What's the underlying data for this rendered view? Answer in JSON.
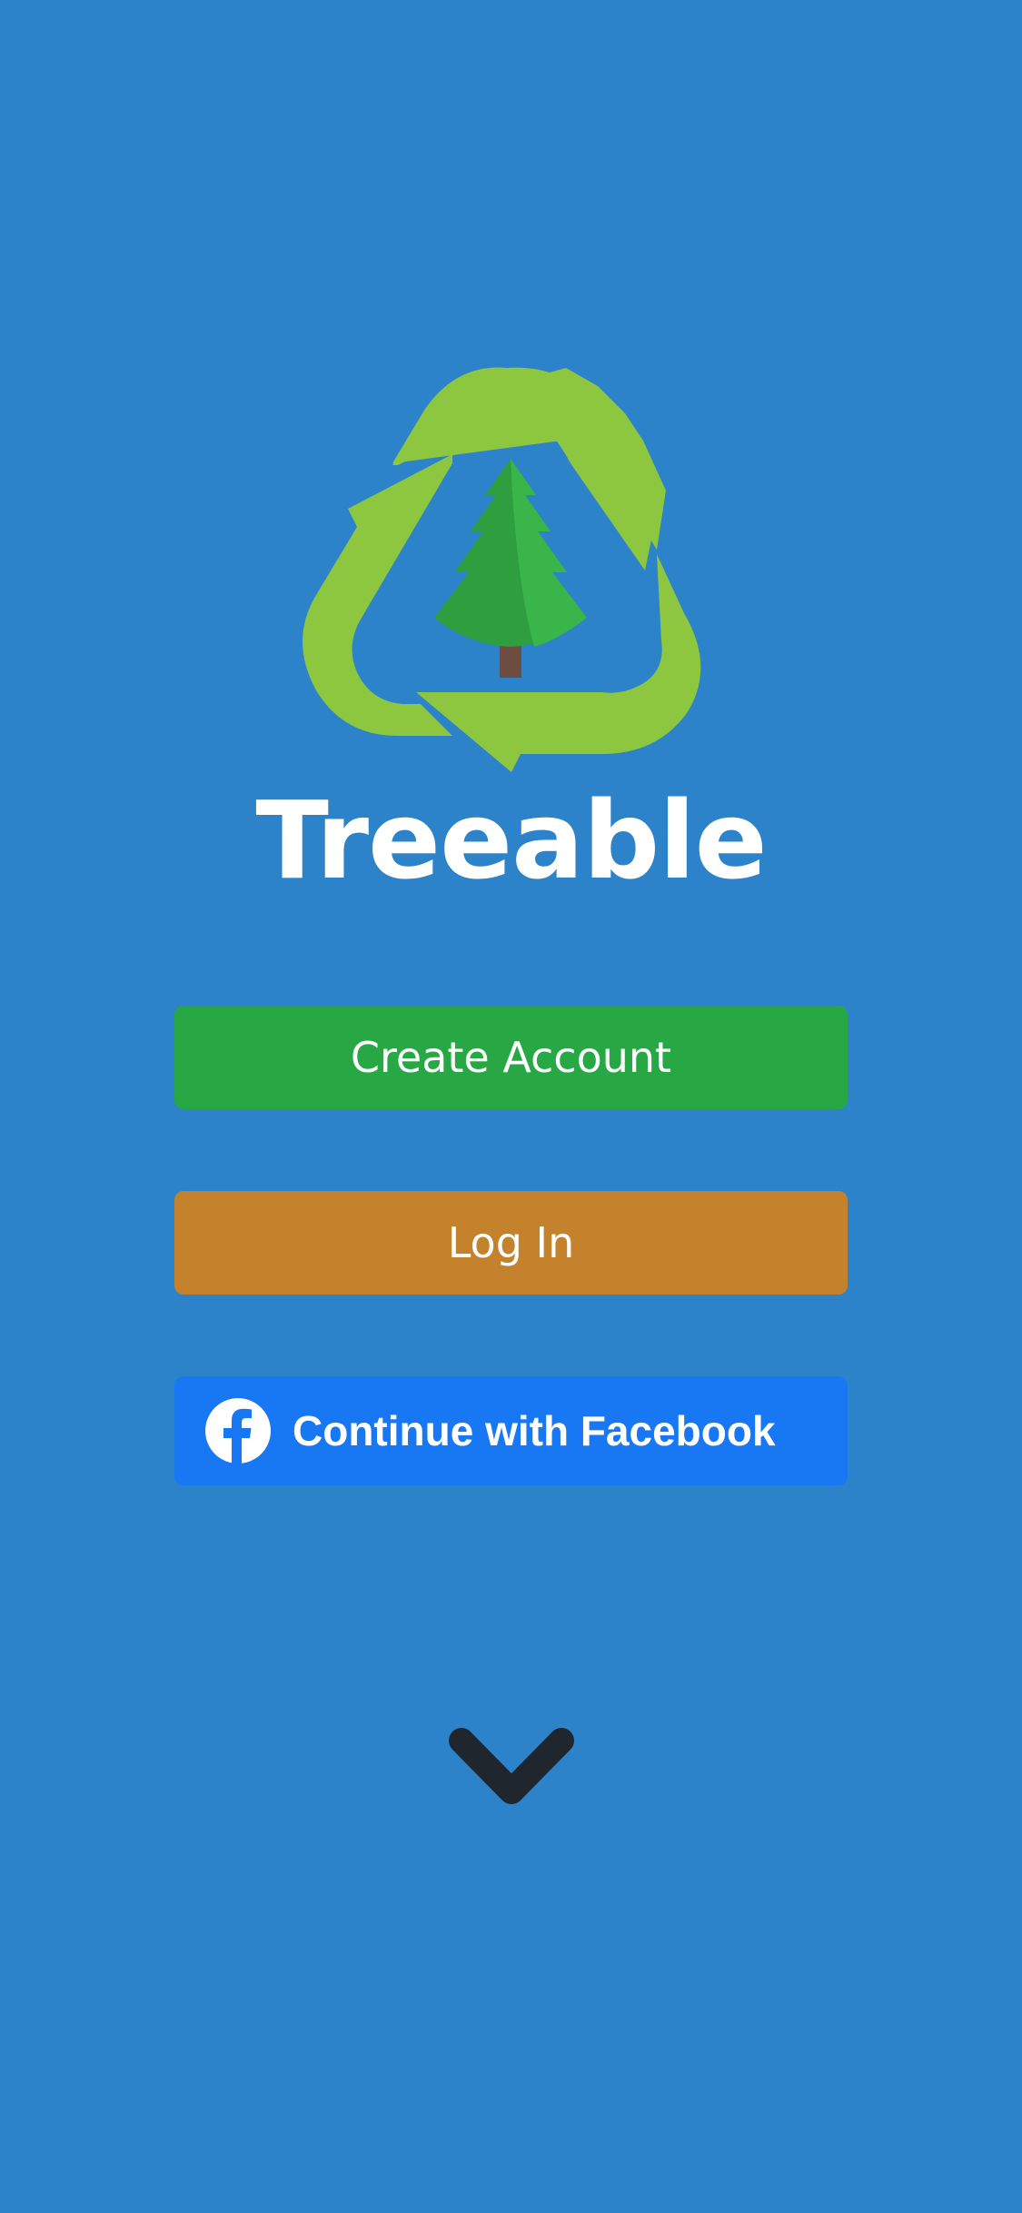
{
  "app": {
    "name": "Treeable"
  },
  "actions": {
    "create_account_label": "Create Account",
    "login_label": "Log In",
    "facebook_label": "Continue with Facebook"
  },
  "icons": {
    "logo": "recycle-tree-logo-icon",
    "facebook": "facebook-icon",
    "scroll": "chevron-down-icon"
  },
  "colors": {
    "background": "#2d83c9",
    "create_account": "#28a745",
    "login": "#c4822d",
    "facebook": "#1877f2",
    "recycle_arrows": "#8dc63f",
    "tree": "#2e9e3e",
    "chevron": "#1f262d"
  }
}
